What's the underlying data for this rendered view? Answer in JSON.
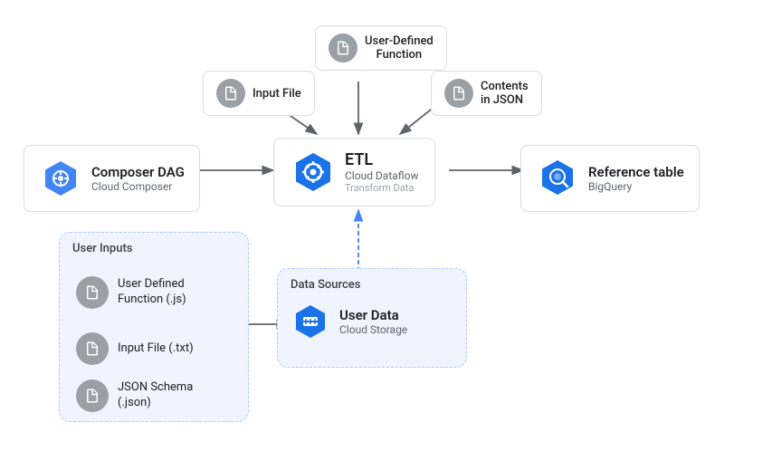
{
  "nodes": {
    "composer_dag": {
      "title": "Composer DAG",
      "subtitle": "Cloud Composer"
    },
    "etl": {
      "title": "ETL",
      "sub1": "Cloud Dataflow",
      "sub2": "Transform Data"
    },
    "reference_table": {
      "title": "Reference table",
      "subtitle": "BigQuery"
    },
    "user_defined_function": {
      "label": "User-Defined\nFunction"
    },
    "input_file_top": {
      "label": "Input File"
    },
    "contents_json": {
      "label": "Contents\nin JSON"
    },
    "user_data": {
      "title": "User Data",
      "subtitle": "Cloud Storage"
    }
  },
  "containers": {
    "user_inputs": {
      "label": "User Inputs",
      "items": [
        {
          "label": "User Defined\nFunction (.js)"
        },
        {
          "label": "Input File (.txt)"
        },
        {
          "label": "JSON Schema\n(.json)"
        }
      ]
    },
    "data_sources": {
      "label": "Data Sources"
    }
  },
  "colors": {
    "blue_hex": "#4285f4",
    "hex_bg": "#1a73e8",
    "gray": "#9aa0a6",
    "border": "#dadce0",
    "dashed_border": "#aecbfa",
    "container_bg": "#e8f0fe"
  }
}
